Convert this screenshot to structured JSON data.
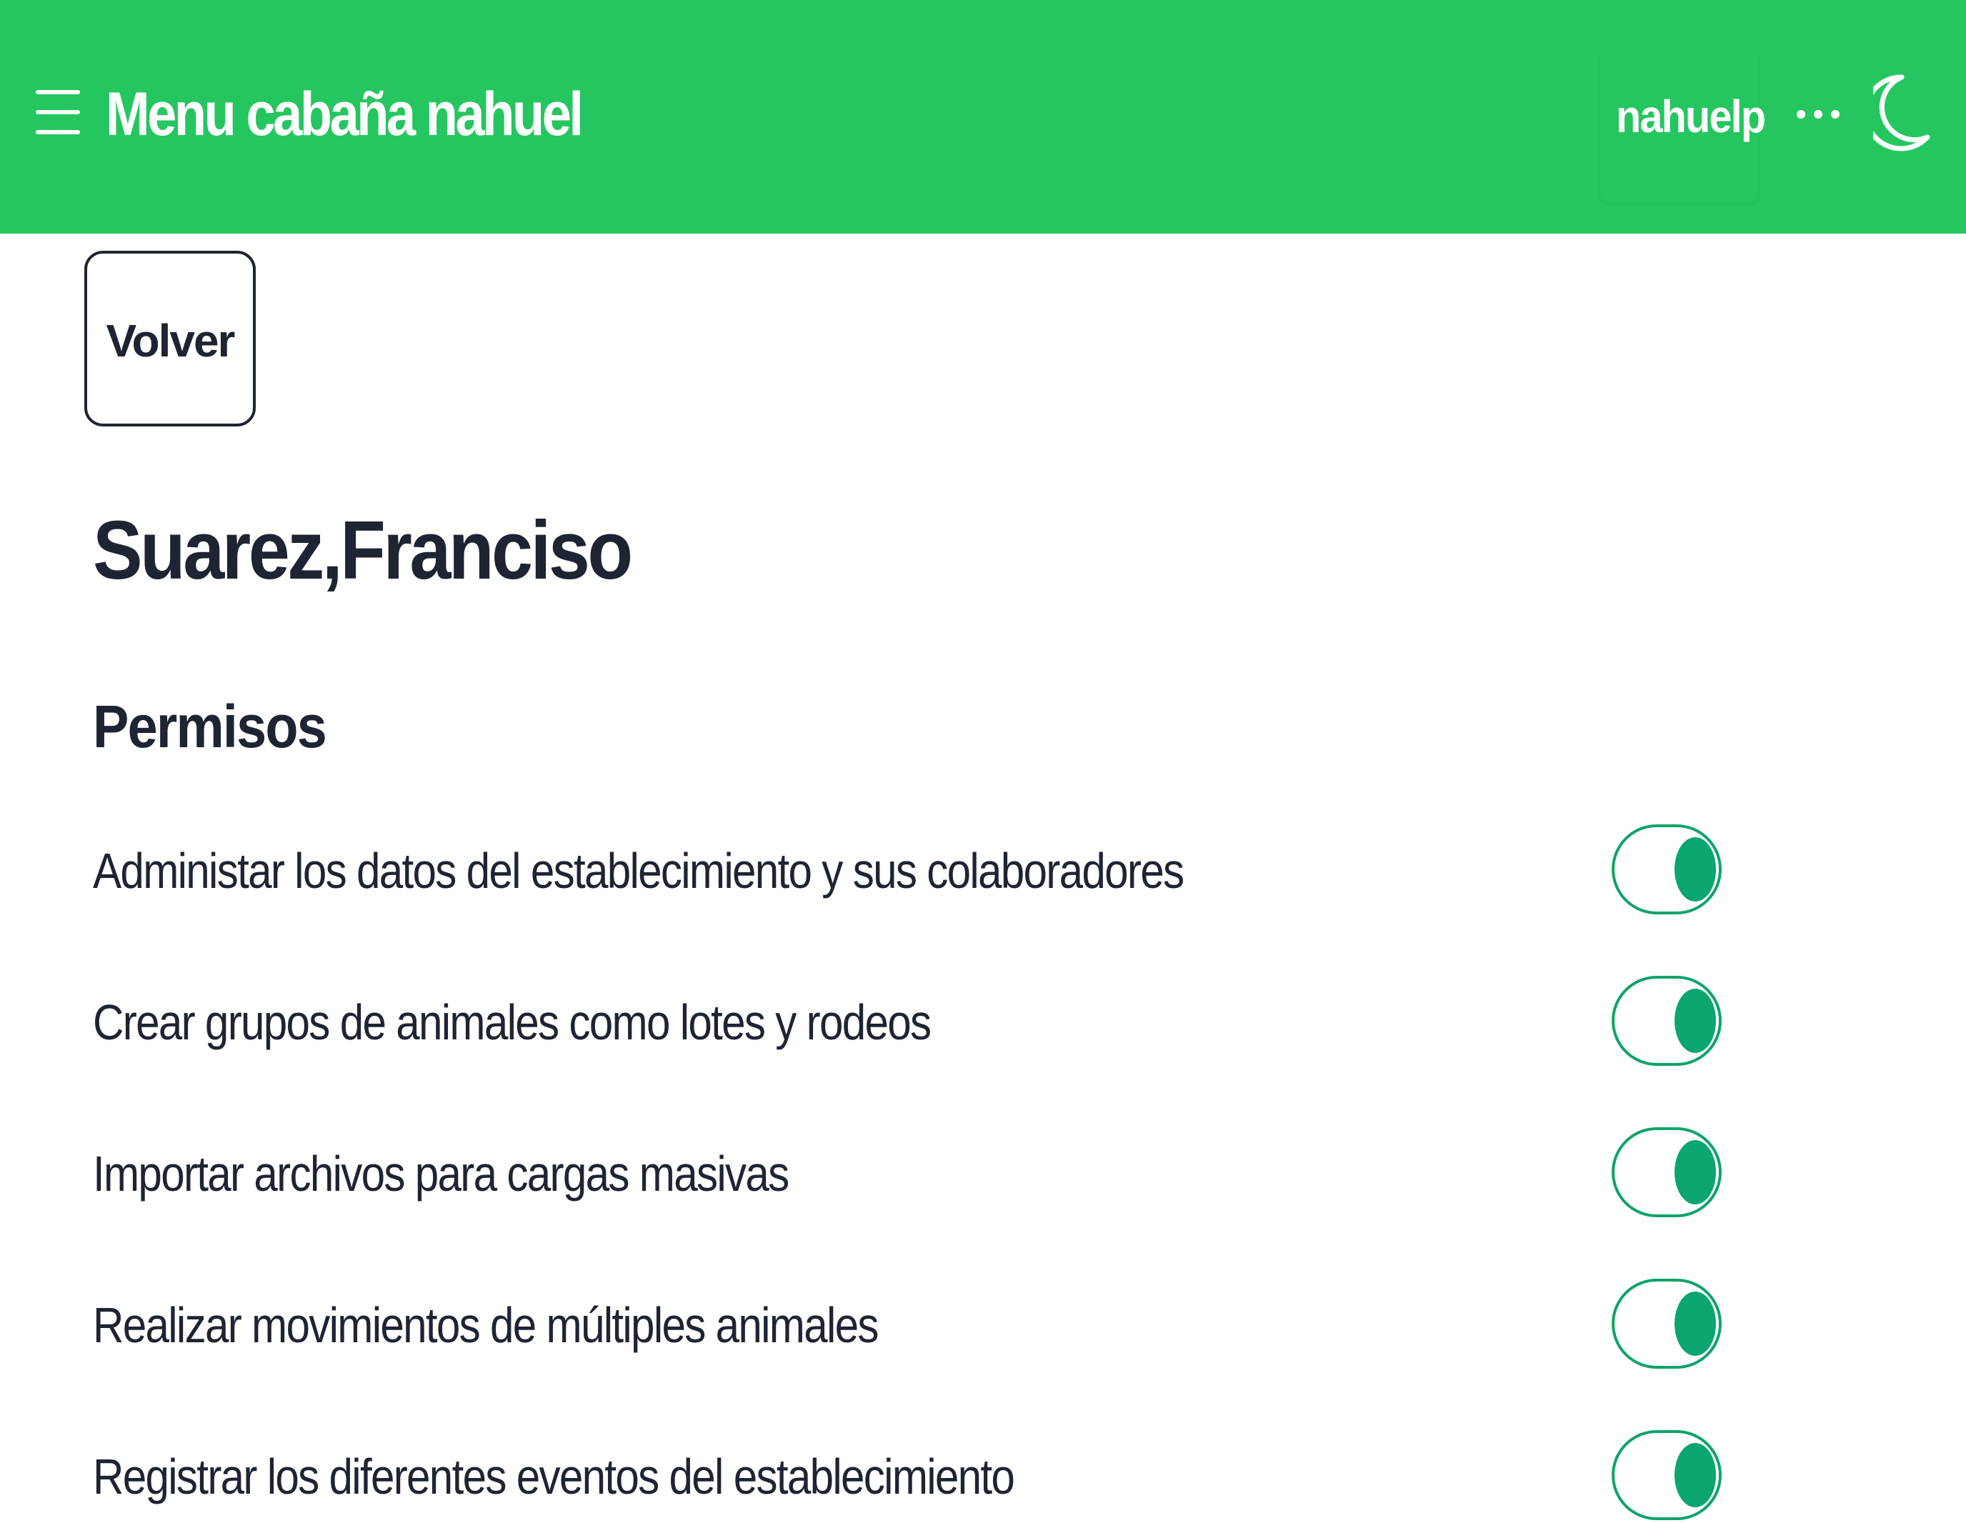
{
  "header": {
    "title": "Menu cabaña nahuel",
    "user": "nahuelp",
    "menu_icon": "hamburger-icon",
    "more_icon": "ellipsis-icon",
    "theme_icon": "moon-icon",
    "bar_color": "#25c660"
  },
  "back_button": {
    "label": "Volver"
  },
  "person": {
    "name": "Suarez,Franciso"
  },
  "permissions": {
    "title": "Permisos",
    "accent_color": "#0aa66e",
    "items": [
      {
        "label": "Administar los datos del establecimiento y sus colaboradores",
        "enabled": true
      },
      {
        "label": "Crear grupos de animales como lotes y rodeos",
        "enabled": true
      },
      {
        "label": "Importar archivos para cargas masivas",
        "enabled": true
      },
      {
        "label": "Realizar movimientos de múltiples animales",
        "enabled": true
      },
      {
        "label": "Registrar los diferentes eventos del establecimiento",
        "enabled": true
      }
    ]
  }
}
